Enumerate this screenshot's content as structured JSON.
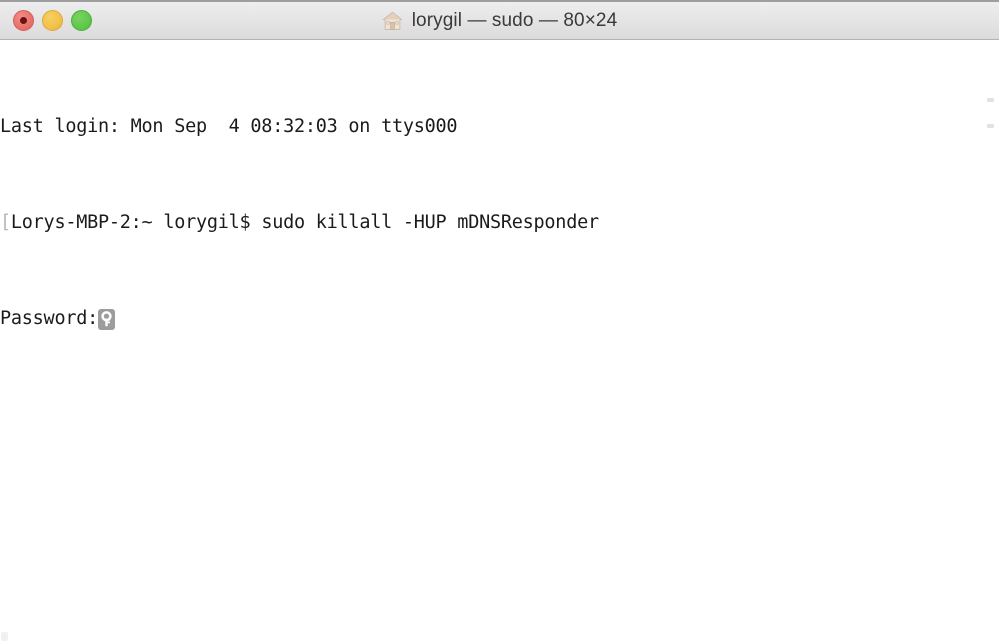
{
  "window": {
    "title_app": "lorygil — sudo — 80×24",
    "home_icon_name": "home-icon",
    "columns": 80,
    "rows": 24,
    "traffic_lights": {
      "close_label": "Close",
      "minimize_label": "Minimize",
      "zoom_label": "Zoom",
      "close_color": "#e8726c",
      "minimize_color": "#f2c14a",
      "zoom_color": "#5ec94b"
    }
  },
  "terminal": {
    "background_color": "#ffffff",
    "text_color": "#1b1b1b",
    "lines": [
      {
        "id": "last-login",
        "text": "Last login: Mon Sep  4 08:32:03 on ttys000"
      },
      {
        "id": "prompt-command",
        "bracket": "[",
        "prompt": "Lorys-MBP-2:~ lorygil$ ",
        "command": "sudo killall -HUP mDNSResponder"
      },
      {
        "id": "password-prompt",
        "text": "Password:",
        "key_icon_name": "key-icon"
      }
    ]
  }
}
